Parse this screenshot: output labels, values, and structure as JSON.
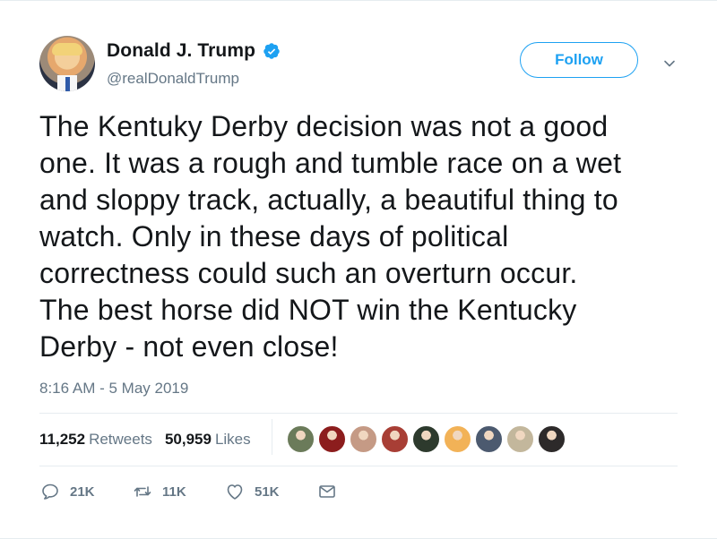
{
  "tweet": {
    "author_name": "Donald J. Trump",
    "handle": "@realDonaldTrump",
    "follow_label": "Follow",
    "text": "The Kentuky Derby decision was not a good\none. It was a rough and tumble race on a wet\nand sloppy track, actually, a beautiful thing to\nwatch. Only in these days of political\ncorrectness could such an overturn occur.\nThe best horse did NOT win the Kentucky\nDerby - not even close!",
    "timestamp": "8:16 AM - 5 May 2019"
  },
  "stats": {
    "retweets_count": "11,252",
    "retweets_label": "Retweets",
    "likes_count": "50,959",
    "likes_label": "Likes"
  },
  "likers": [
    {
      "name": "liker-avatar-1",
      "color": "#6b7b5a"
    },
    {
      "name": "liker-avatar-2",
      "color": "#8c1d1d"
    },
    {
      "name": "liker-avatar-3",
      "color": "#c59a85"
    },
    {
      "name": "liker-avatar-4",
      "color": "#a83e35"
    },
    {
      "name": "liker-avatar-5",
      "color": "#2d3a2d"
    },
    {
      "name": "liker-avatar-6",
      "color": "#f2b257"
    },
    {
      "name": "liker-avatar-7",
      "color": "#4c5a6f"
    },
    {
      "name": "liker-avatar-8",
      "color": "#c3b79c"
    },
    {
      "name": "liker-avatar-9",
      "color": "#2d2a2a"
    }
  ],
  "actions": {
    "replies": "21K",
    "retweets": "11K",
    "likes": "51K"
  },
  "colors": {
    "accent": "#1da1f2",
    "secondary_text": "#657786",
    "divider": "#e6ecf0"
  },
  "icons": {
    "verified": "verified-badge-icon",
    "chevron": "chevron-down-icon",
    "reply": "reply-icon",
    "retweet": "retweet-icon",
    "like": "heart-icon",
    "dm": "envelope-icon"
  }
}
